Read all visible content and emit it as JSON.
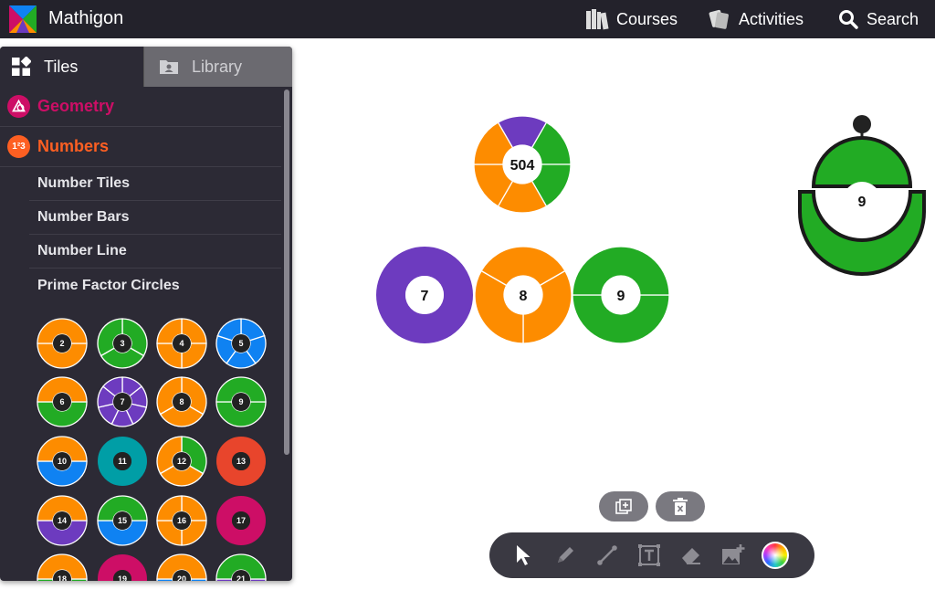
{
  "app": {
    "brand": "Mathigon",
    "nav": [
      {
        "label": "Courses",
        "icon": "books-icon"
      },
      {
        "label": "Activities",
        "icon": "cards-icon"
      },
      {
        "label": "Search",
        "icon": "search-icon"
      }
    ]
  },
  "sidebar": {
    "tabs": [
      {
        "label": "Tiles",
        "icon": "tiles-icon",
        "active": true
      },
      {
        "label": "Library",
        "icon": "folder-user-icon",
        "active": false
      }
    ],
    "categories": [
      {
        "label": "Geometry",
        "color": "#cd0e66",
        "badge": ""
      },
      {
        "label": "Numbers",
        "color": "#fd5f22",
        "badge": "1²3"
      }
    ],
    "subitems": [
      "Number Tiles",
      "Number Bars",
      "Number Line",
      "Prime Factor Circles"
    ],
    "prime_circles": [
      {
        "n": "2",
        "segs": [
          "#fd8c00",
          "#fd8c00"
        ]
      },
      {
        "n": "3",
        "segs": [
          "#22ab24",
          "#22ab24",
          "#22ab24"
        ]
      },
      {
        "n": "4",
        "segs": [
          "#fd8c00",
          "#fd8c00",
          "#fd8c00",
          "#fd8c00"
        ]
      },
      {
        "n": "5",
        "segs": [
          "#0f82f2",
          "#0f82f2",
          "#0f82f2",
          "#0f82f2",
          "#0f82f2"
        ]
      },
      {
        "n": "6",
        "segs": [
          "#22ab24",
          "#fd8c00"
        ]
      },
      {
        "n": "7",
        "segs": [
          "#6d3bbf",
          "#6d3bbf",
          "#6d3bbf",
          "#6d3bbf",
          "#6d3bbf",
          "#6d3bbf",
          "#6d3bbf"
        ]
      },
      {
        "n": "8",
        "segs": [
          "#fd8c00",
          "#fd8c00",
          "#fd8c00"
        ]
      },
      {
        "n": "9",
        "segs": [
          "#22ab24",
          "#22ab24"
        ]
      },
      {
        "n": "10",
        "segs": [
          "#0f82f2",
          "#fd8c00"
        ]
      },
      {
        "n": "11",
        "segs": [
          "#009ea6"
        ]
      },
      {
        "n": "12",
        "segs": [
          "#22ab24",
          "#fd8c00",
          "#fd8c00"
        ]
      },
      {
        "n": "13",
        "segs": [
          "#e8452c"
        ]
      },
      {
        "n": "14",
        "segs": [
          "#6d3bbf",
          "#fd8c00"
        ]
      },
      {
        "n": "15",
        "segs": [
          "#0f82f2",
          "#22ab24"
        ]
      },
      {
        "n": "16",
        "segs": [
          "#fd8c00",
          "#fd8c00",
          "#fd8c00",
          "#fd8c00"
        ]
      },
      {
        "n": "17",
        "segs": [
          "#cd0e66"
        ]
      },
      {
        "n": "18",
        "segs": [
          "#22ab24",
          "#fd8c00"
        ]
      },
      {
        "n": "19",
        "segs": [
          "#cd0e66"
        ]
      },
      {
        "n": "20",
        "segs": [
          "#0f82f2",
          "#fd8c00"
        ]
      },
      {
        "n": "21",
        "segs": [
          "#6d3bbf",
          "#22ab24"
        ]
      }
    ]
  },
  "canvas": {
    "tiles": [
      {
        "n": "504",
        "segs": [
          "#6d3bbf",
          "#22ab24",
          "#22ab24",
          "#fd8c00",
          "#fd8c00",
          "#fd8c00"
        ]
      },
      {
        "n": "7",
        "segs": [
          "#6d3bbf"
        ]
      },
      {
        "n": "8",
        "segs": [
          "#fd8c00",
          "#fd8c00",
          "#fd8c00"
        ]
      },
      {
        "n": "9",
        "segs": [
          "#22ab24",
          "#22ab24"
        ]
      },
      {
        "n": "9",
        "segs": [
          "#22ab24"
        ]
      }
    ]
  },
  "actions": [
    {
      "icon": "duplicate-icon"
    },
    {
      "icon": "delete-icon"
    }
  ],
  "toolbar": [
    {
      "icon": "pointer-icon"
    },
    {
      "icon": "pen-icon"
    },
    {
      "icon": "line-icon"
    },
    {
      "icon": "text-icon"
    },
    {
      "icon": "eraser-icon"
    },
    {
      "icon": "add-image-icon"
    },
    {
      "icon": "color-picker-icon"
    }
  ]
}
